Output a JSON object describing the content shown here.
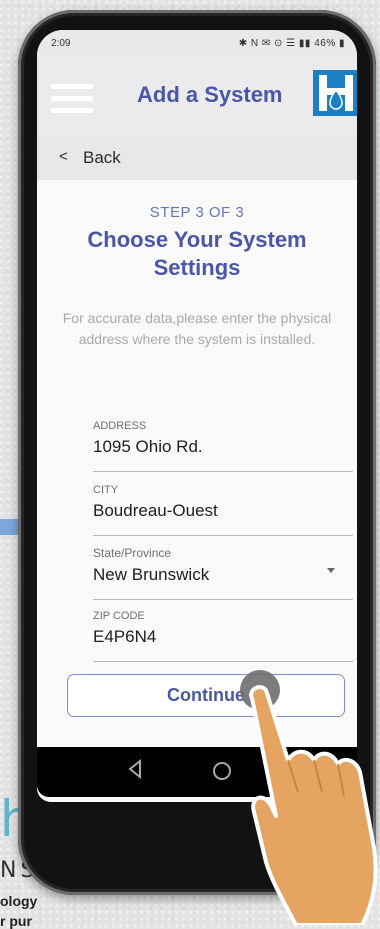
{
  "status_bar": {
    "time": "2:09",
    "icons_text": "✱ N ✉ ⊙ ☰ ▮▮ 46% ▮"
  },
  "app_bar": {
    "title": "Add a System"
  },
  "nav": {
    "back_label": "Back"
  },
  "step": "STEP 3 OF 3",
  "heading": "Choose Your System Settings",
  "description": "For accurate data,please enter the physical address where the system is installed.",
  "form": {
    "address": {
      "label": "ADDRESS",
      "value": "1095 Ohio Rd."
    },
    "city": {
      "label": "CITY",
      "value": "Boudreau-Ouest"
    },
    "state": {
      "label": "State/Province",
      "value": "New Brunswick"
    },
    "zip": {
      "label": "ZIP CODE",
      "value": "E4P6N4"
    }
  },
  "continue_label": "Continue",
  "background_brand": {
    "partial_word": "h",
    "partial_ns": "NS",
    "tagline_1": "ology",
    "tagline_2": "r pur"
  },
  "colors": {
    "primary": "#4a57a8",
    "accent_arrow": "#7ea6da",
    "logo_blue": "#1b7fc3"
  }
}
